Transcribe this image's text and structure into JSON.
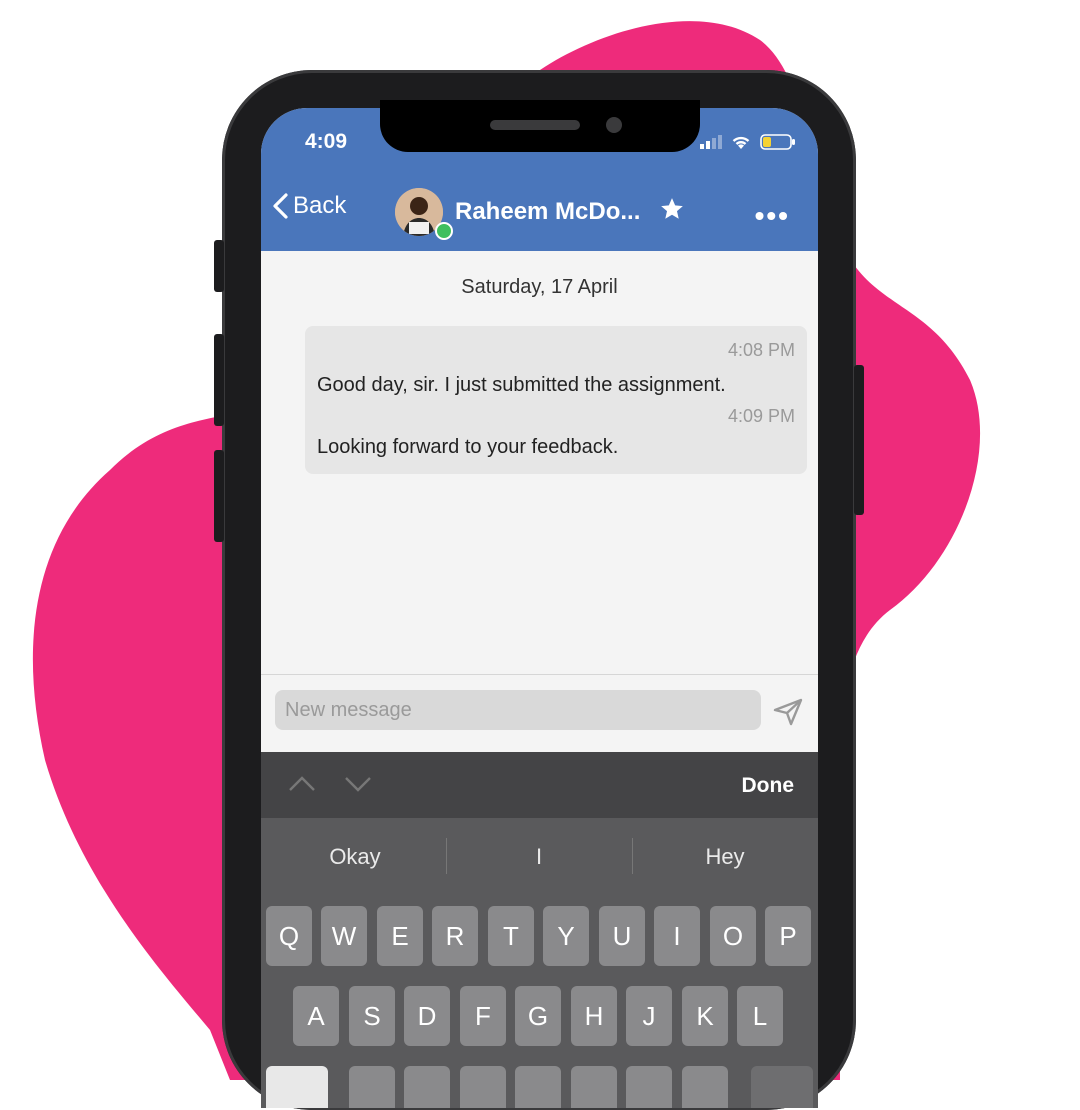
{
  "status_bar": {
    "time": "4:09"
  },
  "nav": {
    "back_label": "Back",
    "contact_name": "Raheem McDo...",
    "more_label": "•••"
  },
  "chat": {
    "date": "Saturday, 17 April",
    "messages": [
      {
        "time": "4:08 PM",
        "text": "Good day, sir. I just submitted the assignment."
      },
      {
        "time": "4:09 PM",
        "text": "Looking forward to your feedback."
      }
    ]
  },
  "composer": {
    "placeholder": "New message"
  },
  "keyboard": {
    "done_label": "Done",
    "suggestions": [
      "Okay",
      "I",
      "Hey"
    ],
    "row1": [
      "Q",
      "W",
      "E",
      "R",
      "T",
      "Y",
      "U",
      "I",
      "O",
      "P"
    ],
    "row2": [
      "A",
      "S",
      "D",
      "F",
      "G",
      "H",
      "J",
      "K",
      "L"
    ]
  },
  "colors": {
    "brand_blue": "#4a76bb",
    "blob_pink": "#ee2b7b",
    "online_green": "#3fbf5f"
  },
  "icons": [
    "chevron-left-icon",
    "star-icon",
    "more-icon",
    "signal-icon",
    "wifi-icon",
    "battery-icon",
    "send-icon",
    "chevron-up-icon",
    "chevron-down-icon"
  ]
}
